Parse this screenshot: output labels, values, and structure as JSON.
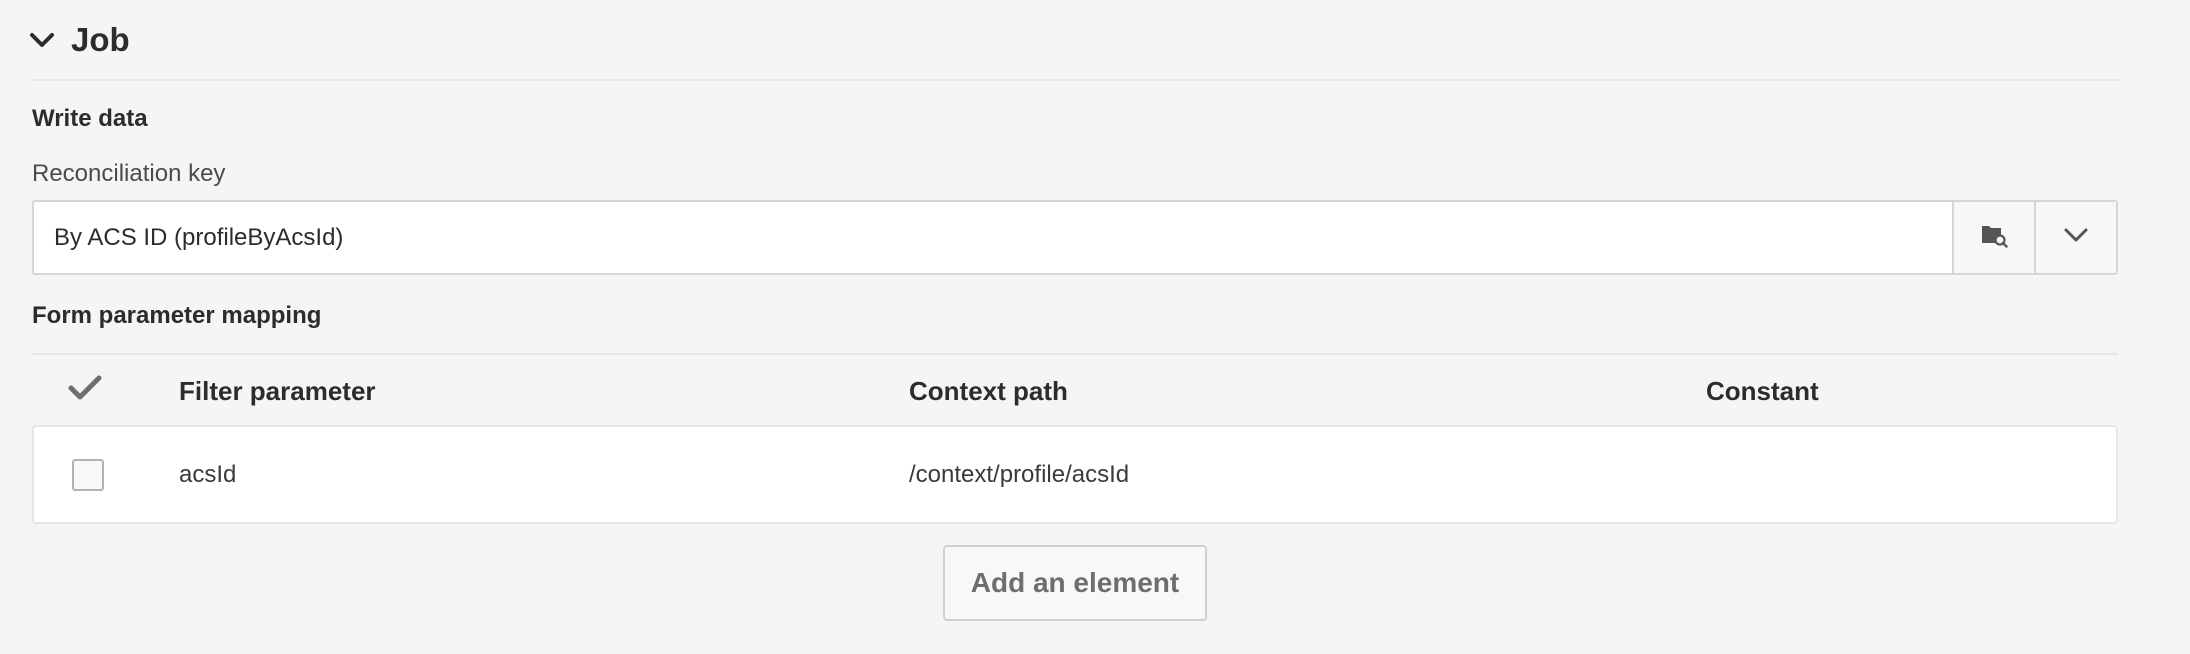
{
  "section": {
    "title": "Job",
    "expand_icon": "chevron-down-icon"
  },
  "write_data": {
    "heading": "Write data",
    "reconciliation_label": "Reconciliation key",
    "reconciliation_value": "By ACS ID (profileByAcsId)",
    "browse_icon": "folder-search-icon",
    "dropdown_icon": "chevron-down-icon"
  },
  "mapping": {
    "heading": "Form parameter mapping",
    "columns": {
      "select_icon": "checkmark-icon",
      "filter_parameter": "Filter parameter",
      "context_path": "Context path",
      "constant": "Constant"
    },
    "rows": [
      {
        "filter_parameter": "acsId",
        "context_path": "/context/profile/acsId",
        "constant": ""
      }
    ],
    "add_button_label": "Add an element"
  },
  "colors": {
    "background": "#f5f5f5",
    "text": "#2c2c2c",
    "border": "#d6d6d6",
    "icon": "#555555"
  }
}
